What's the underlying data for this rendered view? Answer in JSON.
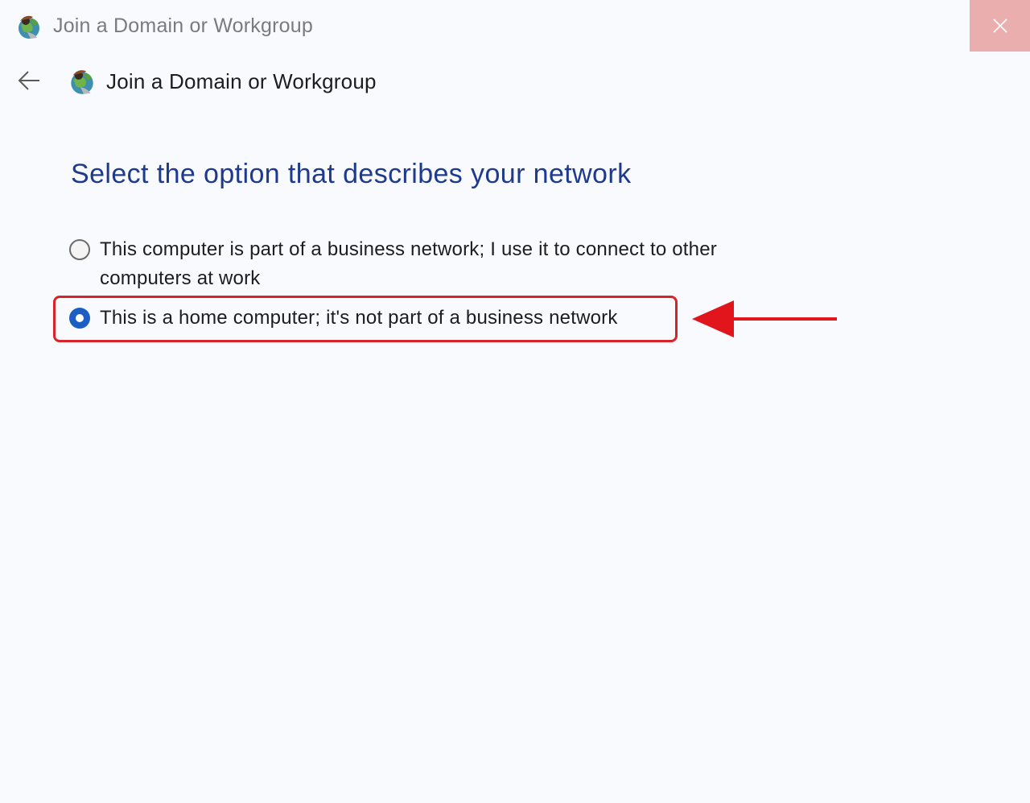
{
  "window": {
    "title": "Join a Domain or Workgroup",
    "close_icon": "close-icon",
    "close_hover_color": "#ebaeae"
  },
  "header": {
    "back_icon": "back-arrow-icon",
    "title": "Join a Domain or Workgroup",
    "icon": "network-globe-icon"
  },
  "main": {
    "heading": "Select the option that describes your network",
    "heading_color": "#1e3a8c",
    "options": [
      {
        "label": "This computer is part of a business network; I use it to connect to other computers at work",
        "selected": false
      },
      {
        "label": "This is a home computer; it's not part of a business network",
        "selected": true
      }
    ]
  },
  "annotation": {
    "highlight_color": "#d9232a",
    "arrow_icon": "red-arrow-left-icon"
  },
  "colors": {
    "background": "#f9fafd",
    "radio_selected": "#1b5fc4",
    "text": "#1d1d1d"
  }
}
